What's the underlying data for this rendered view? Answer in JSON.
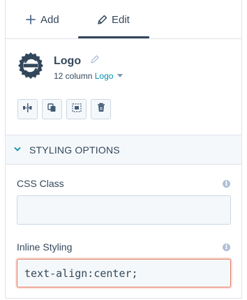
{
  "tabs": [
    {
      "label": "Add",
      "icon": "plus-icon"
    },
    {
      "label": "Edit",
      "icon": "pencil-icon",
      "active": true
    }
  ],
  "module": {
    "title": "Logo",
    "width_label": "12 column",
    "type_label": "Logo",
    "icon": "logo-module-icon"
  },
  "actions": [
    {
      "name": "split-module-button",
      "icon": "split-icon"
    },
    {
      "name": "clone-module-button",
      "icon": "clone-icon"
    },
    {
      "name": "select-area-button",
      "icon": "select-area-icon"
    },
    {
      "name": "delete-module-button",
      "icon": "trash-icon"
    }
  ],
  "section": {
    "title": "STYLING OPTIONS"
  },
  "fields": {
    "css_class": {
      "label": "CSS Class",
      "value": "",
      "info_icon": "info-icon"
    },
    "inline_styling": {
      "label": "Inline Styling",
      "value": "text-align:center;",
      "info_icon": "info-icon"
    }
  },
  "colors": {
    "text": "#33475b",
    "link": "#0091ae",
    "focus_border": "#e07a62",
    "section_bg": "#f5f8fa"
  }
}
